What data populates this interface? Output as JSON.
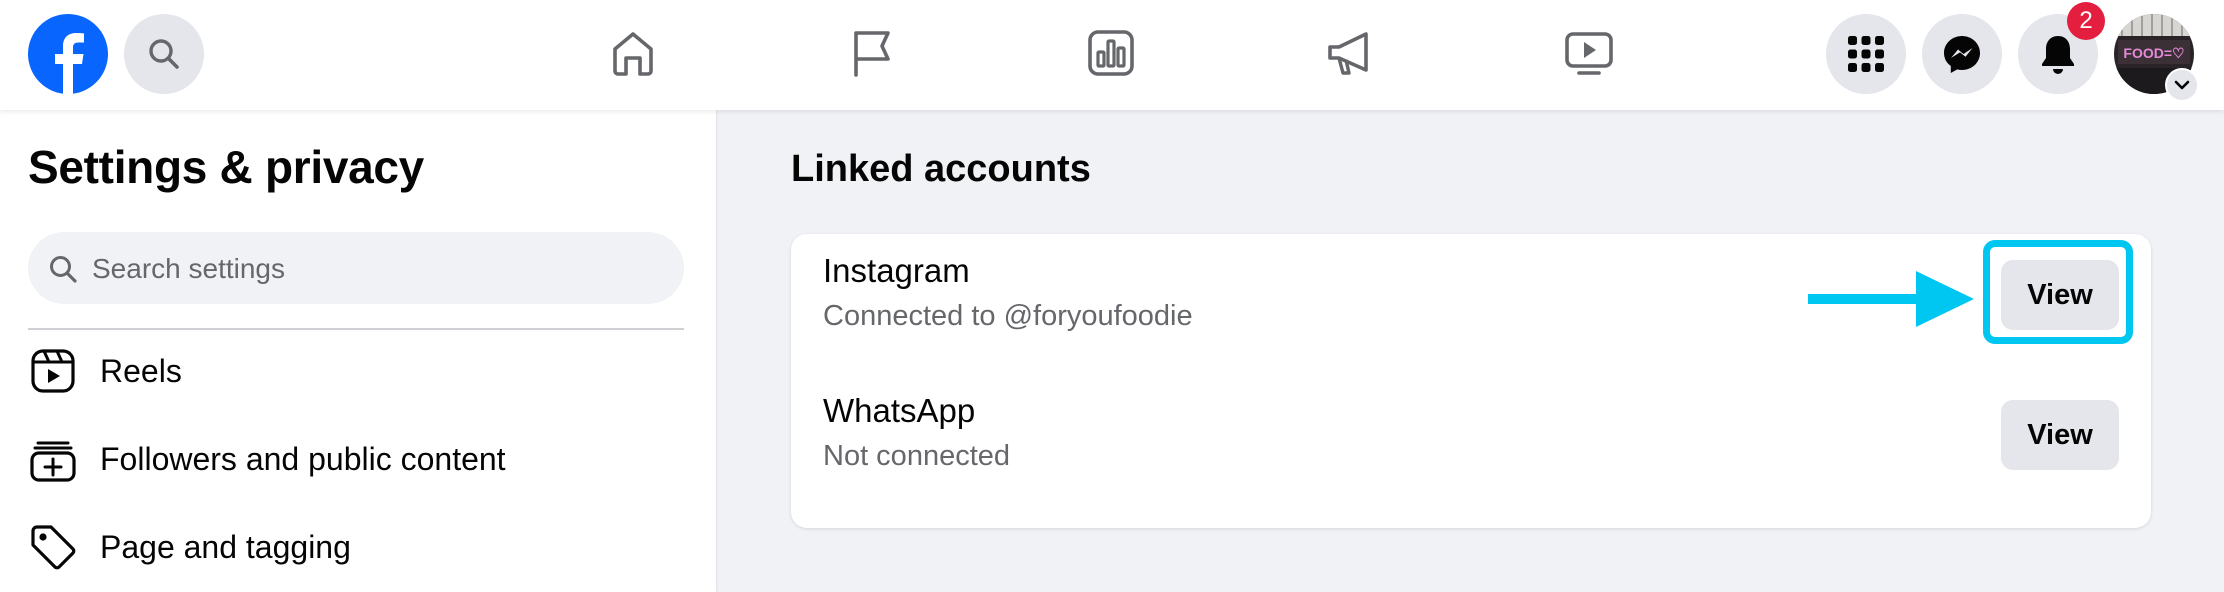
{
  "topbar": {
    "logo_icon": "facebook-logo-icon",
    "search_icon": "search-icon",
    "nav_icons": [
      "home-icon",
      "flag-icon",
      "insights-icon",
      "megaphone-icon",
      "video-icon"
    ],
    "right_icons": [
      "menu-grid-icon",
      "messenger-icon",
      "notifications-icon"
    ],
    "notification_count": "2",
    "avatar_text": "FOOD=♡",
    "accent_color": "#0866ff"
  },
  "sidebar": {
    "title": "Settings & privacy",
    "search_placeholder": "Search settings",
    "items": [
      {
        "label": "Reels",
        "icon": "reels-icon"
      },
      {
        "label": "Followers and public content",
        "icon": "followers-icon"
      },
      {
        "label": "Page and tagging",
        "icon": "tag-icon"
      }
    ]
  },
  "main": {
    "section_title": "Linked accounts",
    "accounts": [
      {
        "name": "Instagram",
        "status": "Connected to @foryoufoodie",
        "button": "View"
      },
      {
        "name": "WhatsApp",
        "status": "Not connected",
        "button": "View"
      }
    ],
    "annotation_color": "#00c6f2"
  }
}
